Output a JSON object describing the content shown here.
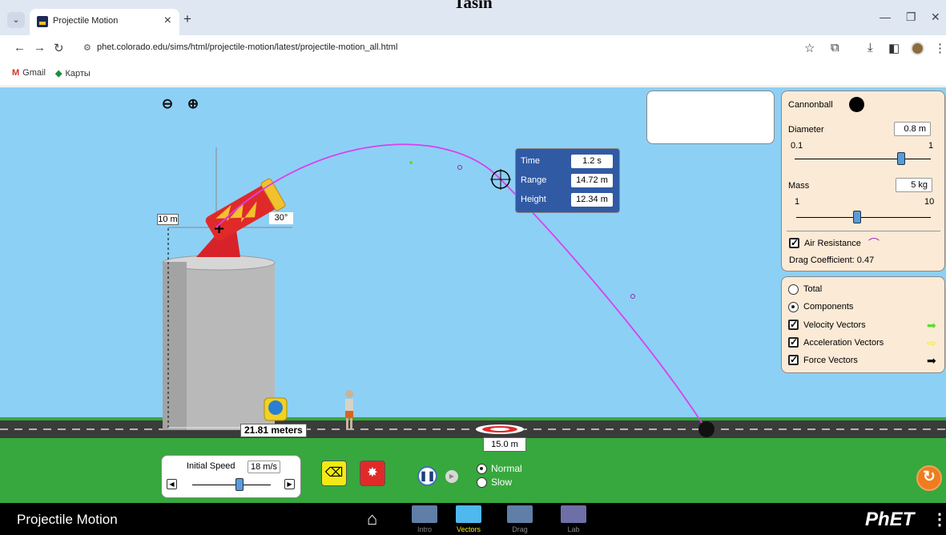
{
  "document_heading": "Tasin",
  "browser": {
    "tab_title": "Projectile Motion",
    "new_tab_symbol": "+",
    "close_symbol": "×",
    "url": "phet.colorado.edu/sims/html/projectile-motion/latest/projectile-motion_all.html",
    "bookmarks": [
      "Gmail",
      "Карты"
    ]
  },
  "sim": {
    "title": "Projectile Motion",
    "screens": [
      {
        "label": "Intro",
        "active": false
      },
      {
        "label": "Vectors",
        "active": true
      },
      {
        "label": "Drag",
        "active": false
      },
      {
        "label": "Lab",
        "active": false
      }
    ],
    "readout": {
      "time_label": "Time",
      "time_value": "1.2 s",
      "range_label": "Range",
      "range_value": "14.72 m",
      "height_label": "Height",
      "height_value": "12.34 m"
    },
    "projectile_panel": {
      "projectile_name": "Cannonball",
      "diameter_label": "Diameter",
      "diameter_value": "0.8 m",
      "diameter_min": "0.1",
      "diameter_max": "1",
      "diameter_level": 0.78,
      "mass_label": "Mass",
      "mass_value": "5 kg",
      "mass_min": "1",
      "mass_max": "10",
      "mass_level": 0.45,
      "air_resistance_label": "Air Resistance",
      "air_resistance_checked": true,
      "drag_coefficient_text": "Drag Coefficient: 0.47"
    },
    "vectors_panel": {
      "total_label": "Total",
      "components_label": "Components",
      "selected": "Components",
      "velocity_label": "Velocity Vectors",
      "acceleration_label": "Acceleration Vectors",
      "force_label": "Force Vectors",
      "velocity_color": "#55e02a",
      "acceleration_color": "#f2e93a",
      "force_color": "#000000"
    },
    "cannon": {
      "height_label": "10 m",
      "angle_label": "30°"
    },
    "tape_measure_label": "21.81 meters",
    "target_label": "15.0 m",
    "initial_speed": {
      "label": "Initial Speed",
      "value": "18 m/s",
      "level": 0.6
    },
    "time_speed": {
      "normal_label": "Normal",
      "slow_label": "Slow",
      "selected": "Normal"
    },
    "colors": {
      "sky": "#8dd0f5",
      "grass": "#37a83d",
      "trajectory": "#d940f0",
      "cannon": "#e02a2a",
      "readout_bg": "#315aa5",
      "panel_bg": "#fbead6",
      "reset": "#ee7d1f"
    },
    "logo_text": "PhET"
  }
}
